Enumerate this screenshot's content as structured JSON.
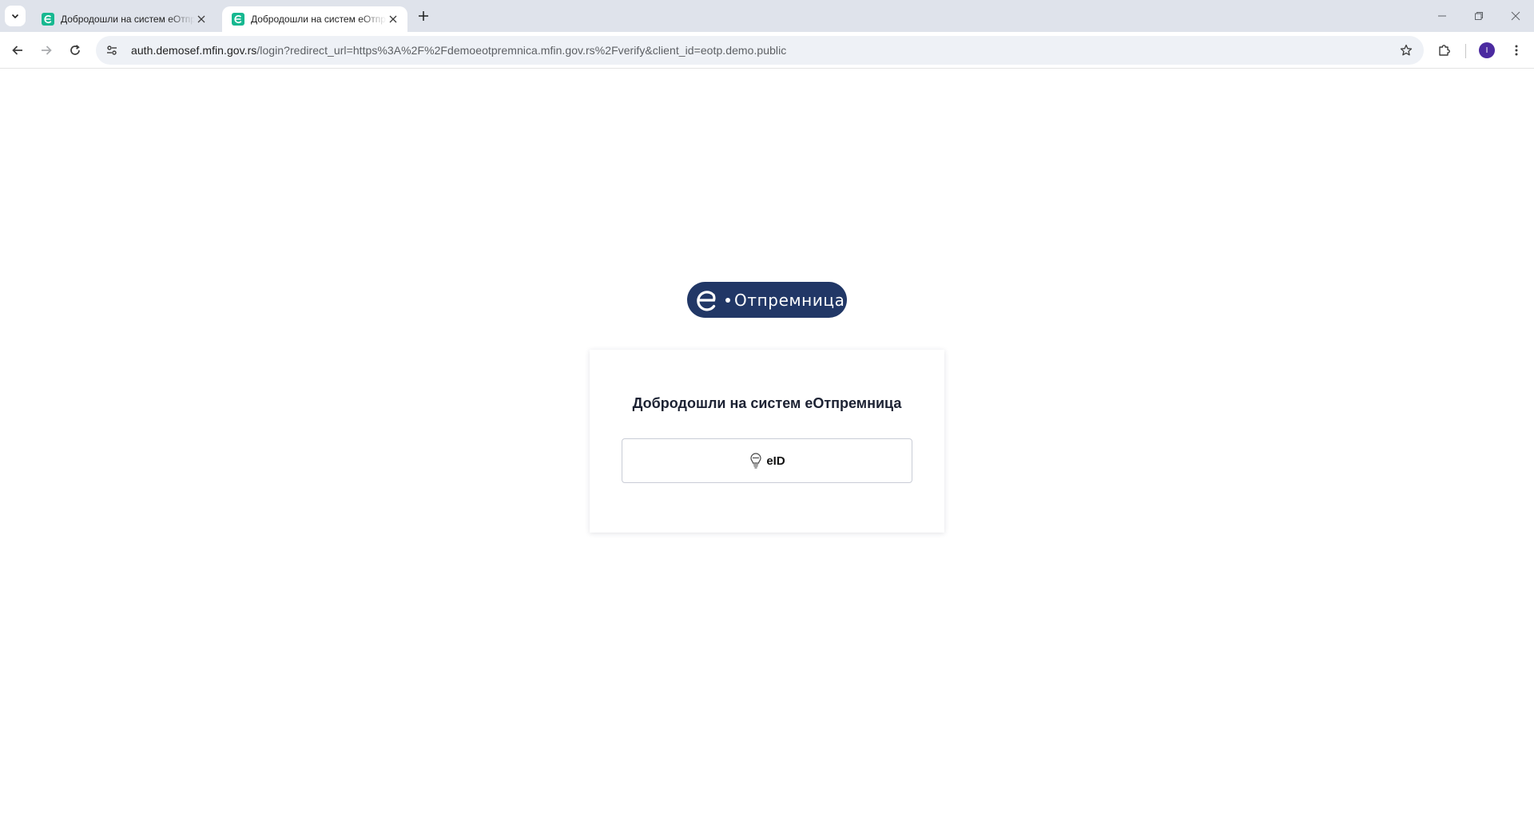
{
  "browser": {
    "tabs": [
      {
        "title": "Добродошли на систем еОтпремница",
        "active": false,
        "favicon": "eotp-favicon"
      },
      {
        "title": "Добродошли на систем еОтпремница",
        "active": true,
        "favicon": "eotp-favicon"
      }
    ],
    "url_host": "auth.demosef.mfin.gov.rs",
    "url_path": "/login?redirect_url=https%3A%2F%2Fdemoeotpremnica.mfin.gov.rs%2Fverify&client_id=eotp.demo.public",
    "profile_initial": "I",
    "profile_color": "#4b2aa0",
    "icons": [
      "tab-search-icon",
      "close-icon",
      "plus-icon",
      "minimize-icon",
      "restore-icon",
      "window-close-icon",
      "back-icon",
      "forward-icon",
      "reload-icon",
      "site-info-icon",
      "star-icon",
      "extensions-icon",
      "kebab-menu-icon"
    ]
  },
  "page": {
    "logo_text": "Отпремница",
    "logo_color": "#213766",
    "card_title": "Добродошли на систем еОтпремница",
    "eid_button_label": "eID",
    "eid_icon": "eid-lightbulb-icon"
  }
}
